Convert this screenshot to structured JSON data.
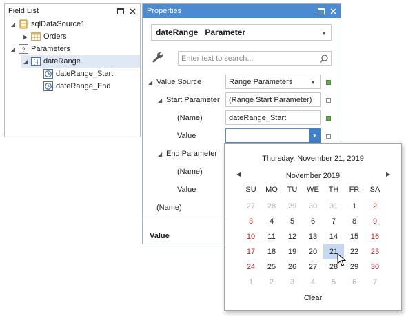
{
  "field_list": {
    "title": "Field List",
    "tree": [
      {
        "label": "sqlDataSource1",
        "icon": "database-icon"
      },
      {
        "label": "Orders",
        "icon": "table-icon"
      },
      {
        "label": "Parameters",
        "icon": "parameters-icon"
      },
      {
        "label": "dateRange",
        "icon": "range-parameter-icon"
      },
      {
        "label": "dateRange_Start",
        "icon": "clock-icon"
      },
      {
        "label": "dateRange_End",
        "icon": "clock-icon"
      }
    ]
  },
  "properties": {
    "title": "Properties",
    "object_name": "dateRange",
    "object_type": "Parameter",
    "search_placeholder": "Enter text to search...",
    "rows": {
      "value_source": {
        "label": "Value Source",
        "value": "Range Parameters"
      },
      "start_parameter": {
        "label": "Start Parameter",
        "value": "(Range Start Parameter)"
      },
      "start_name": {
        "label": "(Name)",
        "value": "dateRange_Start"
      },
      "start_value": {
        "label": "Value",
        "value": ""
      },
      "end_parameter": {
        "label": "End Parameter"
      },
      "end_name": {
        "label": "(Name)"
      },
      "end_value": {
        "label": "Value"
      },
      "name": {
        "label": "(Name)"
      }
    },
    "description_title": "Value"
  },
  "calendar": {
    "today_text": "Thursday, November 21, 2019",
    "month_text": "November 2019",
    "weekdays": [
      "SU",
      "MO",
      "TU",
      "WE",
      "TH",
      "FR",
      "SA"
    ],
    "weeks": [
      [
        "27",
        "28",
        "29",
        "30",
        "31",
        "1",
        "2"
      ],
      [
        "3",
        "4",
        "5",
        "6",
        "7",
        "8",
        "9"
      ],
      [
        "10",
        "11",
        "12",
        "13",
        "14",
        "15",
        "16"
      ],
      [
        "17",
        "18",
        "19",
        "20",
        "21",
        "22",
        "23"
      ],
      [
        "24",
        "25",
        "26",
        "27",
        "28",
        "29",
        "30"
      ],
      [
        "1",
        "2",
        "3",
        "4",
        "5",
        "6",
        "7"
      ]
    ],
    "selected_day": "21",
    "clear_label": "Clear"
  },
  "colors": {
    "accent": "#4c8bd1",
    "weekend": "#c0252a",
    "selected": "#c5daf2",
    "modified_marker": "#6aa84f"
  }
}
